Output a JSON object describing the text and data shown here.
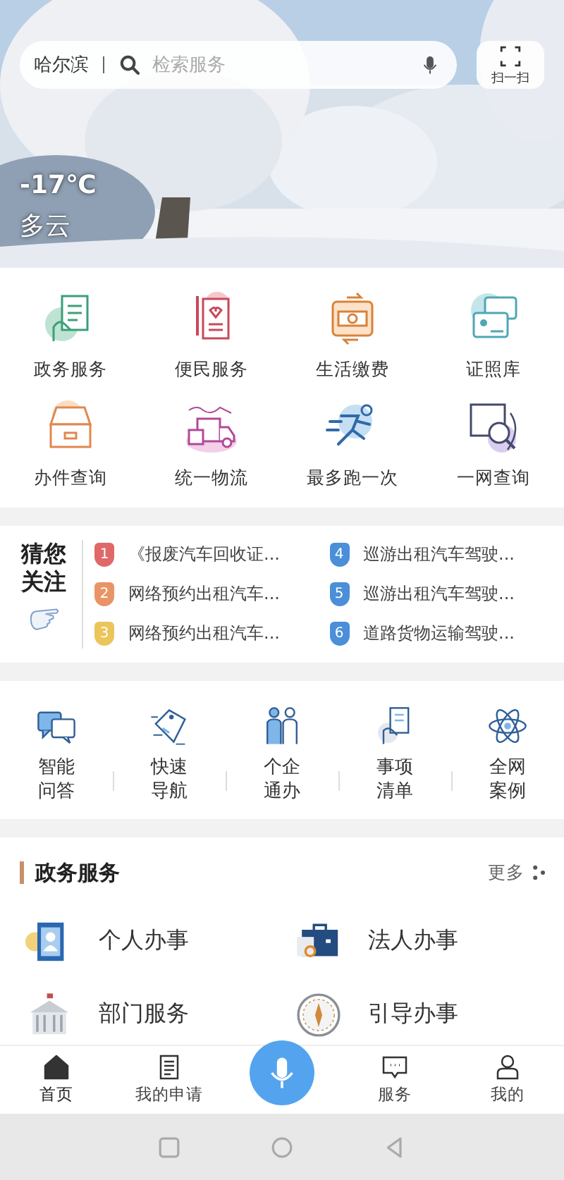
{
  "header": {
    "city": "哈尔滨",
    "search": {
      "placeholder": "检索服务"
    },
    "scan_button": "扫一扫",
    "temperature": "-17℃",
    "weather": "多云"
  },
  "services": [
    {
      "label": "政务服务"
    },
    {
      "label": "便民服务"
    },
    {
      "label": "生活缴费"
    },
    {
      "label": "证照库"
    },
    {
      "label": "办件查询"
    },
    {
      "label": "统一物流"
    },
    {
      "label": "最多跑一次"
    },
    {
      "label": "一网查询"
    }
  ],
  "recommend": {
    "title": "猜您关注",
    "items": [
      {
        "number": "1",
        "text": "《报废汽车回收证...",
        "color": "#e06868"
      },
      {
        "number": "4",
        "text": "巡游出租汽车驾驶...",
        "color": "#4a8fd8"
      },
      {
        "number": "2",
        "text": "网络预约出租汽车...",
        "color": "#e99467"
      },
      {
        "number": "5",
        "text": "巡游出租汽车驾驶...",
        "color": "#4a8fd8"
      },
      {
        "number": "3",
        "text": "网络预约出租汽车...",
        "color": "#ebc55a"
      },
      {
        "number": "6",
        "text": "道路货物运输驾驶...",
        "color": "#4a8fd8"
      }
    ]
  },
  "quick_links": [
    {
      "label": "智能问答"
    },
    {
      "label": "快速导航"
    },
    {
      "label": "个企通办"
    },
    {
      "label": "事项清单"
    },
    {
      "label": "全网案例"
    }
  ],
  "section": {
    "title": "政务服务",
    "more": "更多",
    "items": [
      {
        "label": "个人办事"
      },
      {
        "label": "法人办事"
      },
      {
        "label": "部门服务"
      },
      {
        "label": "引导办事"
      }
    ]
  },
  "bottom_nav": [
    {
      "kind": "tab",
      "label": "首页",
      "selected": true
    },
    {
      "kind": "tab",
      "label": "我的申请",
      "selected": false
    },
    {
      "kind": "voice"
    },
    {
      "kind": "tab",
      "label": "服务",
      "selected": false
    },
    {
      "kind": "tab",
      "label": "我的",
      "selected": false
    }
  ]
}
